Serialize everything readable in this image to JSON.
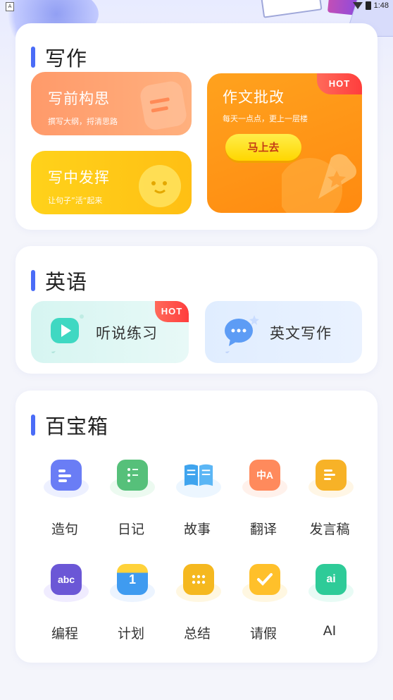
{
  "status_bar": {
    "time": "1:48",
    "indicator": "A"
  },
  "writing": {
    "title": "写作",
    "tiles": {
      "brainstorm": {
        "title": "写前构思",
        "subtitle": "撰写大纲，捋清思路"
      },
      "express": {
        "title": "写中发挥",
        "subtitle": "让句子”活“起来"
      },
      "grading": {
        "title": "作文批改",
        "subtitle": "每天一点点，更上一层楼",
        "badge": "HOT",
        "button": "马上去"
      }
    }
  },
  "english": {
    "title": "英语",
    "tiles": [
      {
        "label": "听说练习",
        "badge": "HOT",
        "icon": "play-icon"
      },
      {
        "label": "英文写作",
        "icon": "chat-bubble-icon"
      }
    ]
  },
  "toolbox": {
    "title": "百宝箱",
    "items": [
      {
        "label": "造句",
        "icon": "sentence-icon",
        "color": "#6a7df5"
      },
      {
        "label": "日记",
        "icon": "diary-icon",
        "color": "#56c07a"
      },
      {
        "label": "故事",
        "icon": "book-icon",
        "color": "#3fa4ee"
      },
      {
        "label": "翻译",
        "icon": "translate-icon",
        "color": "#ff8a5c",
        "glyph": "中A"
      },
      {
        "label": "发言稿",
        "icon": "scroll-icon",
        "color": "#f7b227"
      },
      {
        "label": "编程",
        "icon": "code-icon",
        "color": "#6b57d6",
        "glyph": "abc"
      },
      {
        "label": "计划",
        "icon": "calendar-icon",
        "color": "#3f9bf0",
        "glyph": "1"
      },
      {
        "label": "总结",
        "icon": "summary-icon",
        "color": "#f5b81f"
      },
      {
        "label": "请假",
        "icon": "leave-icon",
        "color": "#ffc02a"
      },
      {
        "label": "AI",
        "icon": "ai-icon",
        "color": "#2ecb98",
        "glyph": "ai"
      }
    ]
  }
}
